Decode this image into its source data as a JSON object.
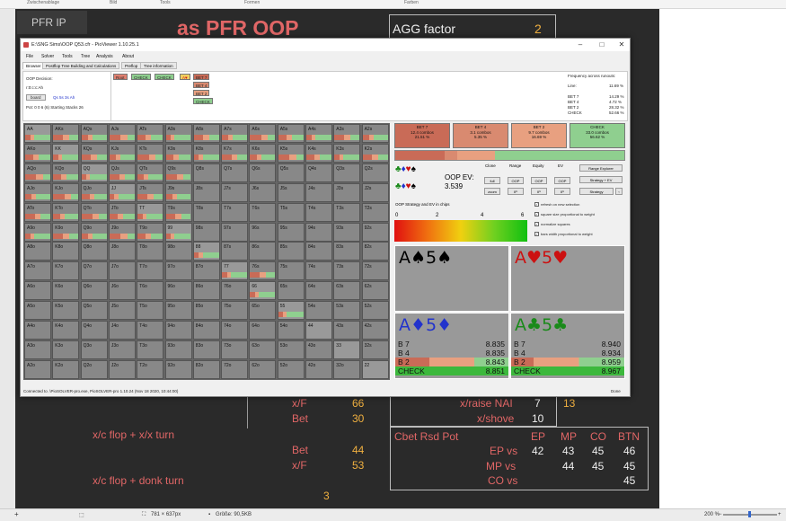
{
  "ribbon": {
    "items": [
      "Zwischenablage",
      "Bild",
      "Tools",
      "Formen",
      "Farben"
    ]
  },
  "slide": {
    "pfr_label": "PFR IP",
    "title": "as PFR OOP",
    "agg_label": "AGG factor",
    "agg_value": "2",
    "rows": {
      "xf1": "x/F",
      "xf1_val": "66",
      "bet1": "Bet",
      "bet1_val": "30",
      "xc_xt": "x/c flop + x/x turn",
      "bet2": "Bet",
      "bet2_val": "44",
      "xf2": "x/F",
      "xf2_val": "53",
      "xc_donk": "x/c flop + donk turn",
      "donk_val": "3",
      "xraise": "x/raise NAI",
      "xraise_v1": "7",
      "xraise_v2": "13",
      "xshove": "x/shove",
      "xshove_val": "10"
    },
    "cbet_table": {
      "title": "Cbet Rsd Pot",
      "headers": [
        "EP",
        "MP",
        "CO",
        "BTN"
      ],
      "rows": [
        {
          "label": "EP vs",
          "values": [
            "42",
            "43",
            "45",
            "46"
          ]
        },
        {
          "label": "MP vs",
          "values": [
            "",
            "44",
            "45",
            "45"
          ]
        },
        {
          "label": "CO vs",
          "values": [
            "",
            "",
            "",
            "45"
          ]
        }
      ]
    }
  },
  "window": {
    "title": "E:\\SNG Sims\\OOP Q53.cfr - PioViewer 1.10.25.1",
    "controls": {
      "min": "–",
      "max": "□",
      "close": "✕"
    },
    "menu": [
      "File",
      "Solver",
      "Tools",
      "Tree",
      "Analysis",
      "About"
    ],
    "tabs": [
      "Browser",
      "Postflop Tree Building and Calculations",
      "Preflop",
      "Tree information"
    ],
    "tree": {
      "decision": "OOP Decision:",
      "board": "r:0:c:c:Ah",
      "board_btn": "board",
      "suits": "Qs  5s  3s  Ah",
      "pot": "Pot: 0 0 6 (6) Starting Stacks 26",
      "nodes": [
        "Root",
        "CHECK",
        "CHECK",
        "A♥",
        "BET 7",
        "BET 4",
        "BET 2",
        "CHECK"
      ],
      "freq_title": "Frequency across runouts:",
      "freq": [
        {
          "label": "Line:",
          "value": "11.69 %"
        },
        {
          "label": "BET 7",
          "value": "14.29 %"
        },
        {
          "label": "BET 4",
          "value": "4.72 %"
        },
        {
          "label": "BET 2",
          "value": "28.32 %"
        },
        {
          "label": "CHECK",
          "value": "52.66 %"
        }
      ]
    },
    "grid": {
      "rows": [
        [
          "AA",
          "AKs",
          "AQs",
          "AJs",
          "ATs",
          "A9s",
          "A8s",
          "A7s",
          "A6s",
          "A5s",
          "A4s",
          "A3s",
          "A2s"
        ],
        [
          "AKo",
          "KK",
          "KQs",
          "KJs",
          "KTs",
          "K9s",
          "K8s",
          "K7s",
          "K6s",
          "K5s",
          "K4s",
          "K3s",
          "K2s"
        ],
        [
          "AQo",
          "KQo",
          "QQ",
          "QJs",
          "QTs",
          "Q9s",
          "Q8s",
          "Q7s",
          "Q6s",
          "Q5s",
          "Q4s",
          "Q3s",
          "Q2s"
        ],
        [
          "AJo",
          "KJo",
          "QJo",
          "JJ",
          "JTs",
          "J9s",
          "J8s",
          "J7s",
          "J6s",
          "J5s",
          "J4s",
          "J3s",
          "J2s"
        ],
        [
          "ATo",
          "KTo",
          "QTo",
          "JTo",
          "TT",
          "T9s",
          "T8s",
          "T7s",
          "T6s",
          "T5s",
          "T4s",
          "T3s",
          "T2s"
        ],
        [
          "A9o",
          "K9o",
          "Q9o",
          "J9o",
          "T9o",
          "99",
          "98s",
          "97s",
          "96s",
          "95s",
          "94s",
          "93s",
          "92s"
        ],
        [
          "A8o",
          "K8o",
          "Q8o",
          "J8o",
          "T8o",
          "98o",
          "88",
          "87s",
          "86s",
          "85s",
          "84s",
          "83s",
          "82s"
        ],
        [
          "A7o",
          "K7o",
          "Q7o",
          "J7o",
          "T7o",
          "97o",
          "87o",
          "77",
          "76s",
          "75s",
          "74s",
          "73s",
          "72s"
        ],
        [
          "A6o",
          "K6o",
          "Q6o",
          "J6o",
          "T6o",
          "96o",
          "86o",
          "76o",
          "66",
          "65s",
          "64s",
          "63s",
          "62s"
        ],
        [
          "A5o",
          "K5o",
          "Q5o",
          "J5o",
          "T5o",
          "95o",
          "85o",
          "75o",
          "65o",
          "55",
          "54s",
          "53s",
          "52s"
        ],
        [
          "A4o",
          "K4o",
          "Q4o",
          "J4o",
          "T4o",
          "94o",
          "84o",
          "74o",
          "64o",
          "54o",
          "44",
          "43s",
          "42s"
        ],
        [
          "A3o",
          "K3o",
          "Q3o",
          "J3o",
          "T3o",
          "93o",
          "83o",
          "73o",
          "63o",
          "53o",
          "43o",
          "33",
          "32s"
        ],
        [
          "A2o",
          "K2o",
          "Q2o",
          "J2o",
          "T2o",
          "92o",
          "82o",
          "72o",
          "62o",
          "52o",
          "42o",
          "32o",
          "22"
        ]
      ]
    },
    "strategy": [
      {
        "label": "BET 7",
        "combos": "12.4 combos",
        "pct": "21.51 %",
        "color": "#c96b57"
      },
      {
        "label": "BET 4",
        "combos": "3.1 combos",
        "pct": "5.35 %",
        "color": "#d98a70"
      },
      {
        "label": "BET 2",
        "combos": "9.7 combos",
        "pct": "16.69 %",
        "color": "#e8a080"
      },
      {
        "label": "CHECK",
        "combos": "33.0 combos",
        "pct": "56.62 %",
        "color": "#8fcf8f"
      }
    ],
    "controls_panel": {
      "oop_ev_label": "OOP EV:",
      "oop_ev_value": "3.539",
      "col_heads": [
        "Clone",
        "Range",
        "Equity",
        "EV"
      ],
      "btns_row1": [
        "full",
        "OOP",
        "OOP",
        "OOP"
      ],
      "btns_row2": [
        "zoom",
        "IP",
        "IP",
        "IP"
      ],
      "range_explorer": "Range Explorer",
      "strategy_ev": "Strategy + EV",
      "strategy": "Strategy",
      "chips_label": "OOP Strategy and EV in chips",
      "scale": [
        "0",
        "2",
        "4",
        "6"
      ],
      "checks": [
        "refresh on new selection",
        "square size proportional to weight",
        "normalize squares",
        "bars width proportional to weight"
      ]
    },
    "hands": [
      {
        "name": "A♠5♠",
        "color": "#000000"
      },
      {
        "name": "A♥5♥",
        "color": "#cc1111"
      },
      {
        "name": "A♦5♦",
        "color": "#2233cc"
      },
      {
        "name": "A♣5♣",
        "color": "#1a8a1a"
      }
    ],
    "ev_left": [
      {
        "label": "B 7",
        "value": "8.835"
      },
      {
        "label": "B 4",
        "value": "8.835"
      },
      {
        "label": "B 2",
        "value": "8.843"
      },
      {
        "label": "CHECK",
        "value": "8.851"
      }
    ],
    "ev_right": [
      {
        "label": "B 7",
        "value": "8.940"
      },
      {
        "label": "B 4",
        "value": "8.934"
      },
      {
        "label": "B 2",
        "value": "8.959"
      },
      {
        "label": "CHECK",
        "value": "8.967"
      }
    ],
    "status": "Connected to .\\PioSOLVER-pro.exe, PioSOLVER-pro 1.10.24 (Nov 18 2020, 10:44:00)",
    "status_right": "Done"
  },
  "statusbar": {
    "size": "781 × 637px",
    "filesize": "Größe: 90,5KB",
    "zoom": "200 %"
  }
}
